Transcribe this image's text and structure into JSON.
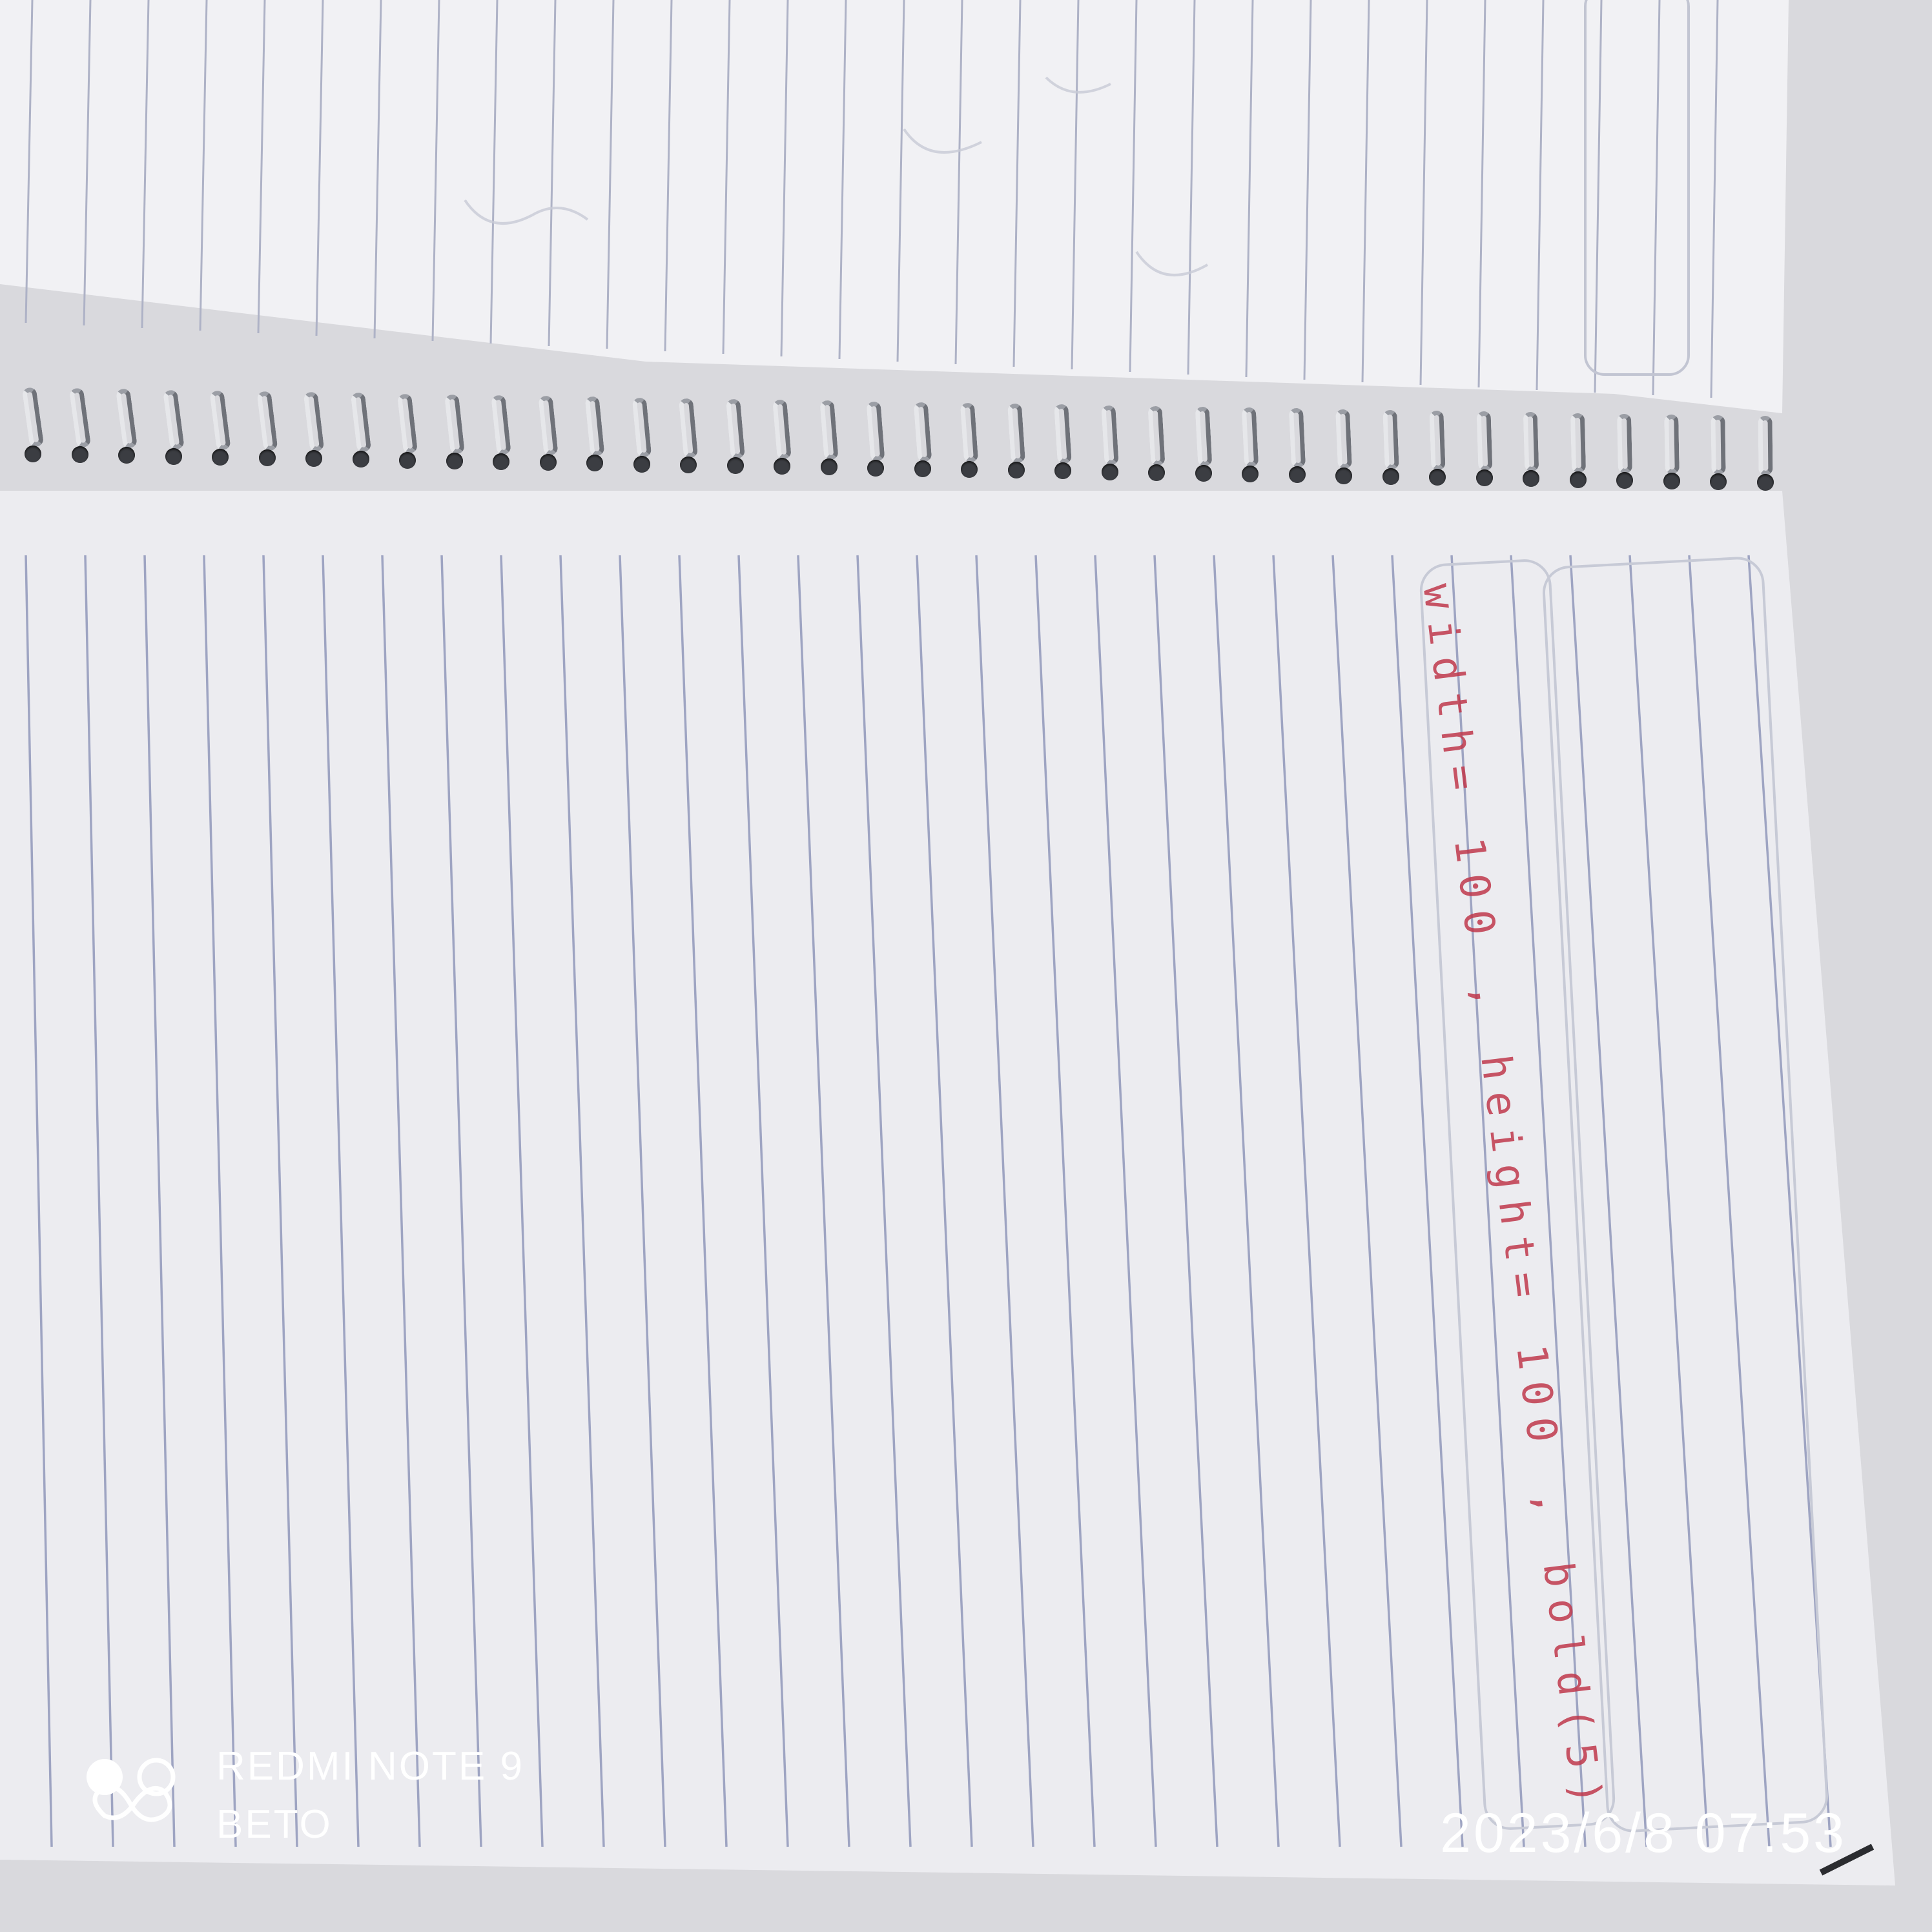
{
  "photo": {
    "subject": "spiral notebook",
    "handwriting_lines": [
      "width= 100 , height= 100 , bold(5)"
    ],
    "handwriting_color": "#c0394c",
    "ink_color_ruled_lines": "#8e95b8"
  },
  "watermark": {
    "logo_icon": "dual-camera-logo-icon",
    "device_model": "REDMI NOTE 9",
    "owner": "BETO",
    "timestamp": "2023/6/8 07:53"
  }
}
